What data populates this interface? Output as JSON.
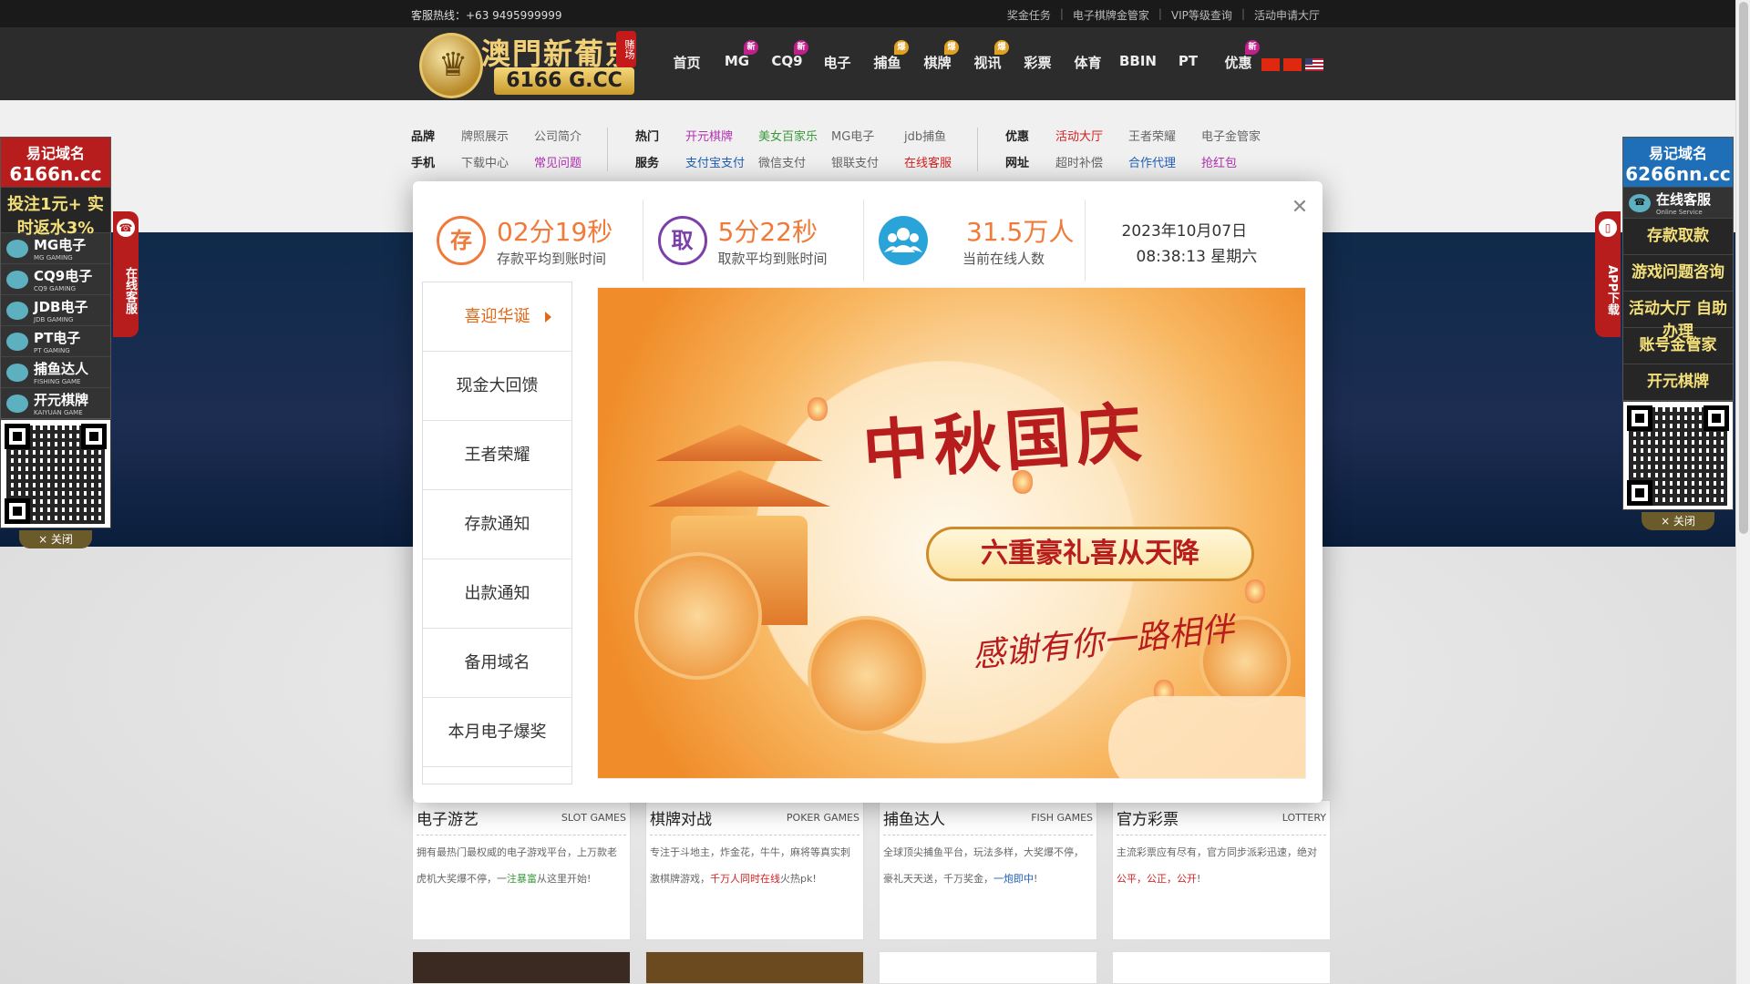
{
  "topbar": {
    "hotline": "客服热线：+63 9495999999",
    "links": [
      "奖金任务",
      "电子棋牌金管家",
      "VIP等级查询",
      "活动申请大厅"
    ]
  },
  "logo": {
    "brand": "澳門新葡京",
    "tag": "赌场",
    "domain": "6166 G.CC"
  },
  "nav": [
    {
      "label": "首页",
      "badge": ""
    },
    {
      "label": "MG",
      "badge": "new"
    },
    {
      "label": "CQ9",
      "badge": "new"
    },
    {
      "label": "电子",
      "badge": ""
    },
    {
      "label": "捕鱼",
      "badge": "hot"
    },
    {
      "label": "棋牌",
      "badge": "hot"
    },
    {
      "label": "视讯",
      "badge": "hot"
    },
    {
      "label": "彩票",
      "badge": ""
    },
    {
      "label": "体育",
      "badge": ""
    },
    {
      "label": "BBIN",
      "badge": ""
    },
    {
      "label": "PT",
      "badge": ""
    },
    {
      "label": "优惠",
      "badge": "new"
    }
  ],
  "submenu": {
    "group1": {
      "row1": {
        "head": "品牌",
        "links": [
          "牌照展示",
          "公司简介"
        ]
      },
      "row2": {
        "head": "手机",
        "links": [
          "下载中心",
          "常见问题"
        ]
      }
    },
    "group2": {
      "row1": {
        "head": "热门",
        "links": [
          "开元棋牌",
          "美女百家乐",
          "MG电子",
          "jdb捕鱼"
        ]
      },
      "row2": {
        "head": "服务",
        "links": [
          "支付宝支付",
          "微信支付",
          "银联支付",
          "在线客服"
        ]
      }
    },
    "group3": {
      "row1": {
        "head": "优惠",
        "links": [
          "活动大厅",
          "王者荣耀",
          "电子金管家"
        ]
      },
      "row2": {
        "head": "网址",
        "links": [
          "超时补偿",
          "合作代理",
          "抢红包"
        ]
      }
    }
  },
  "left_float": {
    "domain_title": "易记域名",
    "domain": "6166n.cc",
    "promo": "投注1元+ 实时返水3%",
    "items": [
      {
        "label": "MG电子",
        "sub": "MG GAMING"
      },
      {
        "label": "CQ9电子",
        "sub": "CQ9 GAMING"
      },
      {
        "label": "JDB电子",
        "sub": "JDB GAMING"
      },
      {
        "label": "PT电子",
        "sub": "PT GAMING"
      },
      {
        "label": "捕鱼达人",
        "sub": "FISHING GAME"
      },
      {
        "label": "开元棋牌",
        "sub": "KAIYUAN GAME"
      }
    ],
    "close": "× 关闭",
    "vtab": "在线客服"
  },
  "right_float": {
    "domain_title": "易记域名",
    "domain": "6266nn.cc",
    "service": "在线客服",
    "service_sub": "Online Service",
    "items": [
      "存款取款",
      "游戏问题咨询",
      "活动大厅 自助办理",
      "账号金管家",
      "开元棋牌"
    ],
    "close": "× 关闭",
    "vtab": "APP下载"
  },
  "modal": {
    "stats": [
      {
        "icon": "存",
        "value": "02分19秒",
        "label": "存款平均到账时间"
      },
      {
        "icon": "取",
        "value": "5分22秒",
        "label": "取款平均到账时间"
      },
      {
        "icon": "",
        "value": "31.5万人",
        "label": "当前在线人数"
      }
    ],
    "date": "2023年10月07日",
    "time": "08:38:13 星期六",
    "tabs": [
      "喜迎华诞",
      "现金大回馈",
      "王者荣耀",
      "存款通知",
      "出款通知",
      "备用域名",
      "本月电子爆奖"
    ],
    "active_tab": 0,
    "promo": {
      "title": "中秋国庆",
      "ribbon": "六重豪礼喜从天降",
      "sub": "感谢有你一路相伴"
    }
  },
  "cards": [
    {
      "title": "电子游艺",
      "en": "SLOT GAMES",
      "desc_a": "拥有最热门最权威的电子游戏平台，上万款老虎机大奖爆不停，一",
      "desc_hl": "注暴富",
      "desc_b": "从这里开始!"
    },
    {
      "title": "棋牌对战",
      "en": "POKER GAMES",
      "desc_a": "专注于斗地主，炸金花，牛牛，麻将等真实刺激棋牌游戏，",
      "desc_hl": "千万人同时在线",
      "desc_b": "火热pk!"
    },
    {
      "title": "捕鱼达人",
      "en": "FISH GAMES",
      "desc_a": "全球顶尖捕鱼平台，玩法多样，大奖爆不停，豪礼天天送，千万奖金，",
      "desc_hl": "一炮即中",
      "desc_b": "!"
    },
    {
      "title": "官方彩票",
      "en": "LOTTERY",
      "desc_a": "主流彩票应有尽有，官方同步派彩迅速，绝对",
      "desc_hl": "公平，公正，公开",
      "desc_b": "!"
    }
  ],
  "colors": {
    "accent_red": "#b81d1d",
    "orange": "#f07a3a",
    "header_bg": "#2c2c2c"
  }
}
